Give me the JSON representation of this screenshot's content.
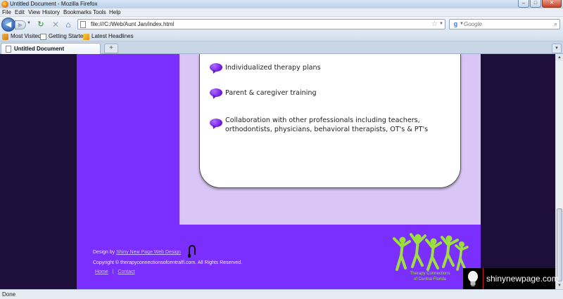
{
  "window": {
    "title": "Untitled Document - Mozilla Firefox",
    "minimize": "–",
    "maximize": "□",
    "close": "✕"
  },
  "menu": [
    "File",
    "Edit",
    "View",
    "History",
    "Bookmarks",
    "Tools",
    "Help"
  ],
  "nav": {
    "url": "file:///C:/Web/Aunt Jan/index.html",
    "search_placeholder": "Google",
    "search_engine_letter": "g",
    "icons": [
      "back-icon",
      "forward-icon",
      "reload-icon",
      "stop-icon",
      "home-icon",
      "star-icon",
      "magnifier-icon"
    ]
  },
  "bookmarks": [
    "Most Visited",
    "Getting Started",
    "Latest Headlines"
  ],
  "tabs": [
    {
      "label": "Untitled Document"
    }
  ],
  "content": {
    "bullets": [
      "Individualized therapy plans",
      "Parent & caregiver training",
      "Collaboration with other professionals including teachers, orthodontists, physicians, behavioral therapists, OT's & PT's"
    ],
    "footer": {
      "design_label": "Design by",
      "design_link": "Shiny New Page Web Design",
      "copyright": "Copyright © therapyconnectionsofcentralfl.com. All Rights Reserved.",
      "links": [
        "Home",
        "Contact"
      ],
      "separator": "|"
    },
    "logo_text_line1": "Therapy Connections",
    "logo_text_line2": "of Central Florida"
  },
  "watermark": "shinynewpage.com",
  "status": "Done",
  "colors": {
    "site_purple": "#7b2fff",
    "lilac_panel": "#d9c6f6",
    "page_background": "#1d0f3a",
    "logo_green": "#9be03b"
  }
}
